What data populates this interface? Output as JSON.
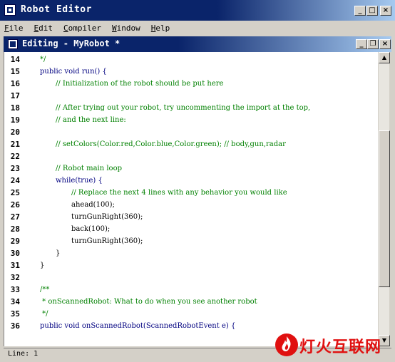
{
  "app": {
    "title": "Robot Editor"
  },
  "window_controls": {
    "minimize": "_",
    "maximize": "□",
    "close": "×",
    "restore": "❐"
  },
  "menu": [
    "File",
    "Edit",
    "Compiler",
    "Window",
    "Help"
  ],
  "editor": {
    "title": "Editing - MyRobot *",
    "lines": [
      {
        "num": "14",
        "text": "*/",
        "indent": 1,
        "style": "comment"
      },
      {
        "num": "15",
        "text": "public void run() {",
        "indent": 1,
        "style": "keyword"
      },
      {
        "num": "16",
        "text": "// Initialization of the robot should be put here",
        "indent": 2,
        "style": "comment"
      },
      {
        "num": "17",
        "text": "",
        "indent": 0,
        "style": "normal"
      },
      {
        "num": "18",
        "text": "// After trying out your robot, try uncommenting the import at the top,",
        "indent": 2,
        "style": "comment"
      },
      {
        "num": "19",
        "text": "// and the next line:",
        "indent": 2,
        "style": "comment"
      },
      {
        "num": "20",
        "text": "",
        "indent": 0,
        "style": "normal"
      },
      {
        "num": "21",
        "text": "// setColors(Color.red,Color.blue,Color.green); // body,gun,radar",
        "indent": 2,
        "style": "comment"
      },
      {
        "num": "22",
        "text": "",
        "indent": 0,
        "style": "normal"
      },
      {
        "num": "23",
        "text": "// Robot main loop",
        "indent": 2,
        "style": "comment"
      },
      {
        "num": "24",
        "text": "while(true) {",
        "indent": 2,
        "style": "keyword"
      },
      {
        "num": "25",
        "text": "// Replace the next 4 lines with any behavior you would like",
        "indent": 3,
        "style": "comment"
      },
      {
        "num": "26",
        "text": "ahead(100);",
        "indent": 3,
        "style": "normal"
      },
      {
        "num": "27",
        "text": "turnGunRight(360);",
        "indent": 3,
        "style": "normal"
      },
      {
        "num": "28",
        "text": "back(100);",
        "indent": 3,
        "style": "normal"
      },
      {
        "num": "29",
        "text": "turnGunRight(360);",
        "indent": 3,
        "style": "normal"
      },
      {
        "num": "30",
        "text": "}",
        "indent": 2,
        "style": "normal"
      },
      {
        "num": "31",
        "text": "}",
        "indent": 1,
        "style": "normal"
      },
      {
        "num": "32",
        "text": "",
        "indent": 0,
        "style": "normal"
      },
      {
        "num": "33",
        "text": "/**",
        "indent": 1,
        "style": "comment"
      },
      {
        "num": "34",
        "text": " * onScannedRobot: What to do when you see another robot",
        "indent": 1,
        "style": "comment"
      },
      {
        "num": "35",
        "text": " */",
        "indent": 1,
        "style": "comment"
      },
      {
        "num": "36",
        "text": "public void onScannedRobot(ScannedRobotEvent e) {",
        "indent": 1,
        "style": "keyword"
      }
    ]
  },
  "status": {
    "text": "Line: 1"
  },
  "watermark": {
    "text": "灯火互联网"
  },
  "colors": {
    "title_active": "#0a246a",
    "comment": "#008000",
    "keyword": "#000080",
    "chrome": "#d4d0c8",
    "watermark": "#e01010"
  }
}
